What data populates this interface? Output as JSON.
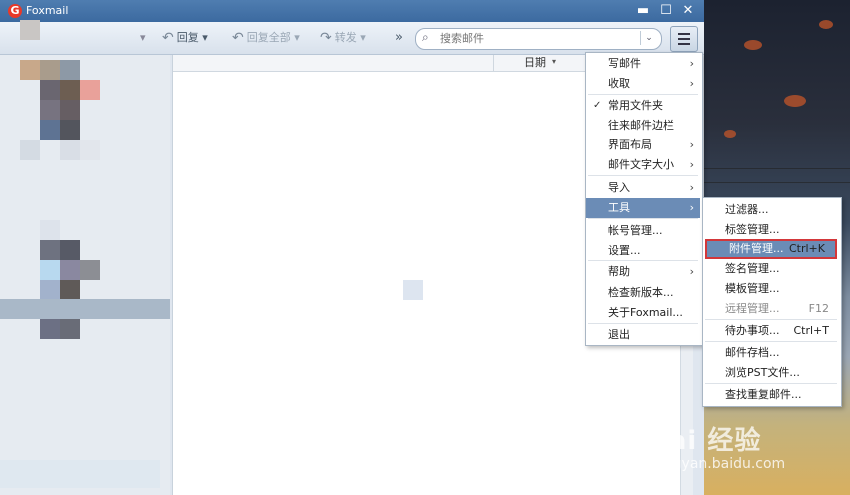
{
  "app": {
    "title": "Foxmail",
    "logo_letter": "G"
  },
  "window_controls": {
    "minimize": "▬",
    "maximize": "☐",
    "close": "✕"
  },
  "toolbar": {
    "reply": "回复",
    "reply_all": "回复全部",
    "forward": "转发",
    "more": "»"
  },
  "search": {
    "placeholder": "搜索邮件"
  },
  "list": {
    "date_header": "日期"
  },
  "main_menu": [
    {
      "label": "写邮件",
      "submenu": true
    },
    {
      "label": "收取",
      "submenu": true
    },
    {
      "label": "常用文件夹",
      "checked": true
    },
    {
      "label": "往来邮件边栏"
    },
    {
      "label": "界面布局",
      "submenu": true
    },
    {
      "label": "邮件文字大小",
      "submenu": true
    },
    {
      "label": "导入",
      "submenu": true
    },
    {
      "label": "工具",
      "submenu": true,
      "highlighted": true
    },
    {
      "label": "帐号管理..."
    },
    {
      "label": "设置..."
    },
    {
      "label": "帮助",
      "submenu": true
    },
    {
      "label": "检查新版本..."
    },
    {
      "label": "关于Foxmail..."
    },
    {
      "label": "退出"
    }
  ],
  "tools_menu": [
    {
      "label": "过滤器..."
    },
    {
      "label": "标签管理..."
    },
    {
      "label": "附件管理...",
      "shortcut": "Ctrl+K",
      "highlighted": true
    },
    {
      "label": "签名管理..."
    },
    {
      "label": "模板管理..."
    },
    {
      "label": "远程管理...",
      "shortcut": "F12",
      "disabled": true
    },
    {
      "label": "待办事项...",
      "shortcut": "Ctrl+T"
    },
    {
      "label": "邮件存档..."
    },
    {
      "label": "浏览PST文件..."
    },
    {
      "label": "查找重复邮件..."
    }
  ],
  "watermark": {
    "main": "Bai 经验",
    "sub": "jingyan.baidu.com"
  },
  "colors": {
    "menu_highlight": "#6b8cb6",
    "annotation_box": "#d3373a",
    "titlebar": "#3c6aa0"
  }
}
